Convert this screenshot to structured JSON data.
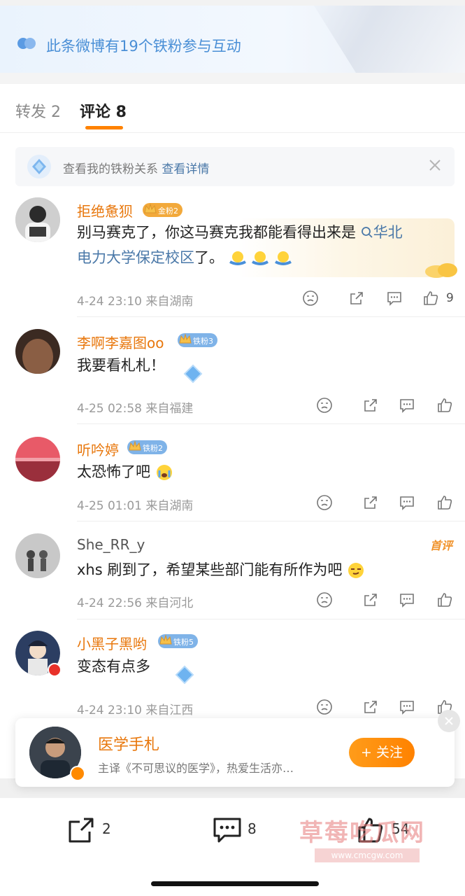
{
  "banner": {
    "text": "此条微博有19个铁粉参与互动"
  },
  "tabs": {
    "repost": "转发 2",
    "comment": "评论 8"
  },
  "fan_bar": {
    "text": "查看我的铁粉关系",
    "link": "查看详情"
  },
  "comments": [
    {
      "username": "拒绝惫狈",
      "badge": "金粉2",
      "text_before": "别马赛克了，你这马赛克我都能看得出来是 ",
      "topic": "华北",
      "text_line2_topic": "电力大学保定校区",
      "text_after": "了。",
      "meta": "4-24 23:10  来自湖南",
      "likes": "9"
    },
    {
      "username": "李啊李嘉图oo",
      "badge": "铁粉3",
      "text": "我要看札札！",
      "meta": "4-25 02:58  来自福建"
    },
    {
      "username": "听吟婷",
      "badge": "铁粉2",
      "text": "太恐怖了吧",
      "meta": "4-25 01:01  来自湖南"
    },
    {
      "username": "She_RR_y",
      "tag": "首评",
      "text": "xhs 刷到了，希望某些部门能有所作为吧",
      "meta": "4-24 22:56  来自河北"
    },
    {
      "username": "小黑子黑哟",
      "badge": "铁粉5",
      "text": "变态有点多",
      "meta": "4-24 23:10  来自江西"
    }
  ],
  "follow_card": {
    "name": "医学手札",
    "desc": "主译《不可思议的医学》，热爱生活亦…",
    "button": "+ 关注"
  },
  "bottom_bar": {
    "reposts": "2",
    "comments": "8",
    "likes": "54"
  },
  "watermark": {
    "text": "草莓吃瓜网",
    "url": "www.cmcgw.com"
  },
  "colors": {
    "accent": "#ff8200",
    "username": "#e8770c",
    "link": "#4a78a8"
  }
}
